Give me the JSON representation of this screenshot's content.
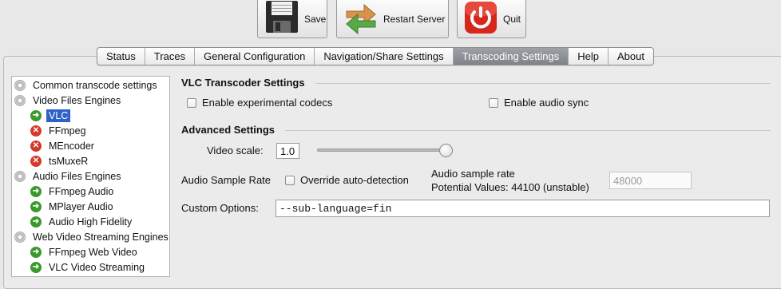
{
  "toolbar": {
    "save_label": "Save",
    "restart_label": "Restart Server",
    "quit_label": "Quit"
  },
  "tabs": [
    {
      "label": "Status"
    },
    {
      "label": "Traces"
    },
    {
      "label": "General Configuration"
    },
    {
      "label": "Navigation/Share Settings"
    },
    {
      "label": "Transcoding Settings",
      "active": true
    },
    {
      "label": "Help"
    },
    {
      "label": "About"
    }
  ],
  "tree": {
    "items": [
      {
        "label": "Common transcode settings",
        "icon": "gear-icon"
      },
      {
        "label": "Video Files Engines",
        "icon": "gear-icon"
      },
      {
        "label": "VLC",
        "icon": "enabled-arrow-icon",
        "selected": true
      },
      {
        "label": "FFmpeg",
        "icon": "disabled-x-icon"
      },
      {
        "label": "MEncoder",
        "icon": "disabled-x-icon"
      },
      {
        "label": "tsMuxeR",
        "icon": "disabled-x-icon"
      },
      {
        "label": "Audio Files Engines",
        "icon": "gear-icon"
      },
      {
        "label": "FFmpeg Audio",
        "icon": "enabled-arrow-icon"
      },
      {
        "label": "MPlayer Audio",
        "icon": "enabled-arrow-icon"
      },
      {
        "label": "Audio High Fidelity",
        "icon": "enabled-arrow-icon"
      },
      {
        "label": "Web Video Streaming Engines",
        "icon": "gear-icon"
      },
      {
        "label": "FFmpeg Web Video",
        "icon": "enabled-arrow-icon"
      },
      {
        "label": "VLC Video Streaming",
        "icon": "enabled-arrow-icon"
      }
    ]
  },
  "vlc": {
    "section_title": "VLC Transcoder Settings",
    "experimental_label": "Enable experimental codecs",
    "audio_sync_label": "Enable audio sync"
  },
  "advanced": {
    "section_title": "Advanced Settings",
    "video_scale_label": "Video scale:",
    "video_scale_value": "1.0",
    "video_scale_slider_fraction": 1.0,
    "audio_sample_rate_label": "Audio Sample Rate",
    "override_label": "Override auto-detection",
    "sample_rate_caption": "Audio sample rate",
    "potential_values": "Potential Values: 44100 (unstable)",
    "sample_rate_value": "48000",
    "custom_options_label": "Custom Options:",
    "custom_options_value": "--sub-language=fin"
  },
  "colors": {
    "selection": "#2f62c9",
    "active_tab": "#8a8e94",
    "enabled_icon": "#3a9a2b",
    "disabled_icon": "#d23a2b"
  }
}
